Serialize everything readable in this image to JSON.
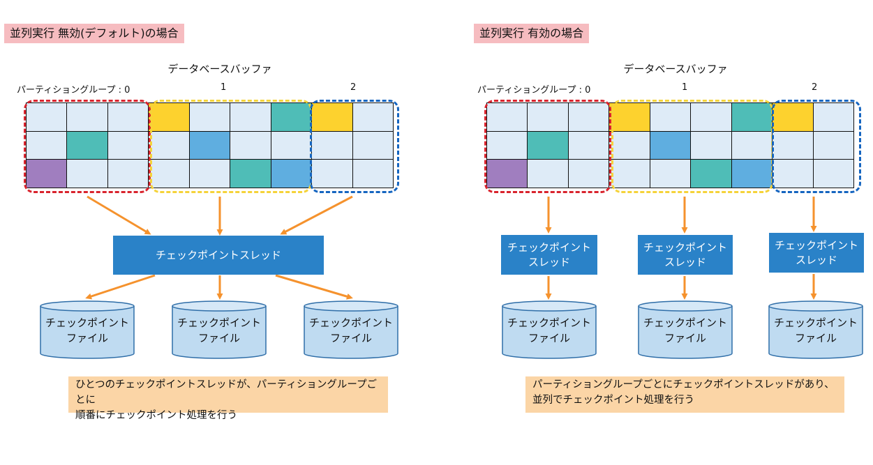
{
  "colors": {
    "cell_default": "#deebf7",
    "yellow": "#fdd22e",
    "teal": "#4fbdb7",
    "blue": "#5faee0",
    "purple": "#a07ebf",
    "group0_border": "#d9232d",
    "group1_border": "#f5d33a",
    "group2_border": "#1565c0",
    "thread_box": "#2a82c8",
    "arrow": "#f5922d",
    "title_tag_bg": "#f6bcc0",
    "note_bg": "#fbd5a6"
  },
  "cell_colors": [
    [
      "",
      "",
      "",
      "yellow",
      "",
      "",
      "teal",
      "yellow"
    ],
    [
      "",
      "teal",
      "",
      "",
      "blue",
      "",
      "",
      ""
    ],
    [
      "purple",
      "",
      "",
      "",
      "",
      "teal",
      "blue",
      ""
    ]
  ],
  "left": {
    "title": "並列実行 無効(デフォルト)の場合",
    "buffer_title": "データベースバッファ",
    "group_labels": [
      "パーティショングループ : 0",
      "1",
      "2"
    ],
    "thread_label": "チェックポイントスレッド",
    "files": [
      "チェックポイント\nファイル",
      "チェックポイント\nファイル",
      "チェックポイント\nファイル"
    ],
    "note": "ひとつのチェックポイントスレッドが、パーティショングループごとに\n順番にチェックポイント処理を行う"
  },
  "right": {
    "title": "並列実行 有効の場合",
    "buffer_title": "データベースバッファ",
    "group_labels": [
      "パーティショングループ : 0",
      "1",
      "2"
    ],
    "threads": [
      "チェックポイント\nスレッド",
      "チェックポイント\nスレッド",
      "チェックポイント\nスレッド"
    ],
    "files": [
      "チェックポイント\nファイル",
      "チェックポイント\nファイル",
      "チェックポイント\nファイル"
    ],
    "note": "パーティショングループごとにチェックポイントスレッドがあり、\n並列でチェックポイント処理を行う"
  }
}
